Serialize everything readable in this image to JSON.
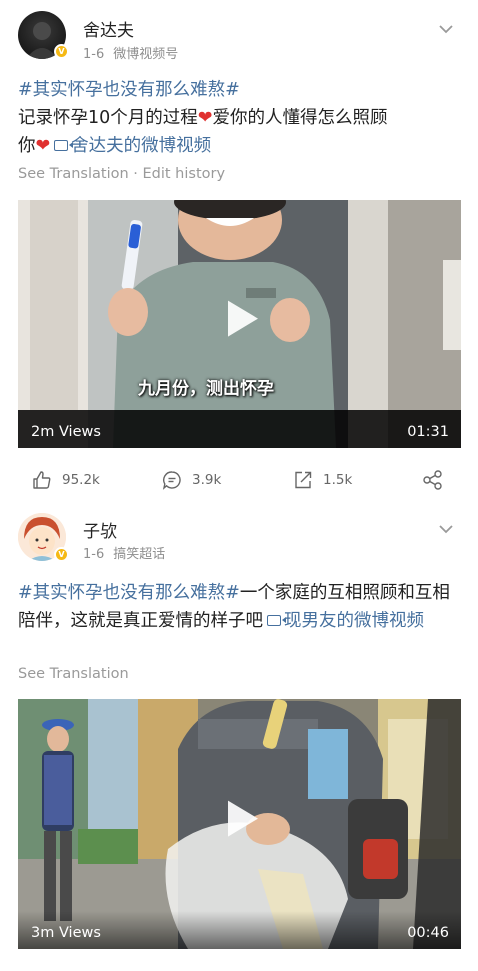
{
  "post1": {
    "username": "舍达夫",
    "date": "1-6",
    "source": "微博视频号",
    "hashtag": "#其实怀孕也没有那么难熬#",
    "text1": "记录怀孕10个月的过程",
    "heart": "❤",
    "text2": "爱你的人懂得怎么照顾",
    "text3": "你",
    "link": "舍达夫的微博视频",
    "sub": "See Translation · Edit history",
    "video": {
      "caption": "九月份，测出怀孕",
      "views": "2m Views",
      "duration": "01:31"
    },
    "actions": {
      "likes": "95.2k",
      "comments": "3.9k",
      "reposts": "1.5k"
    }
  },
  "post2": {
    "username": "子欤",
    "date": "1-6",
    "source": "搞笑超话",
    "hashtag": "#其实怀孕也没有那么难熬#",
    "text1": "一个家庭的互相照顾和互相陪伴，这就是真正爱情的样子吧",
    "link": "现男友的微博视频",
    "sub": "See Translation",
    "video": {
      "views": "3m Views",
      "duration": "00:46"
    }
  },
  "colors": {
    "link": "#46709e",
    "heart": "#e0302f",
    "badge": "#f5b915",
    "muted": "#8e8e8e"
  }
}
